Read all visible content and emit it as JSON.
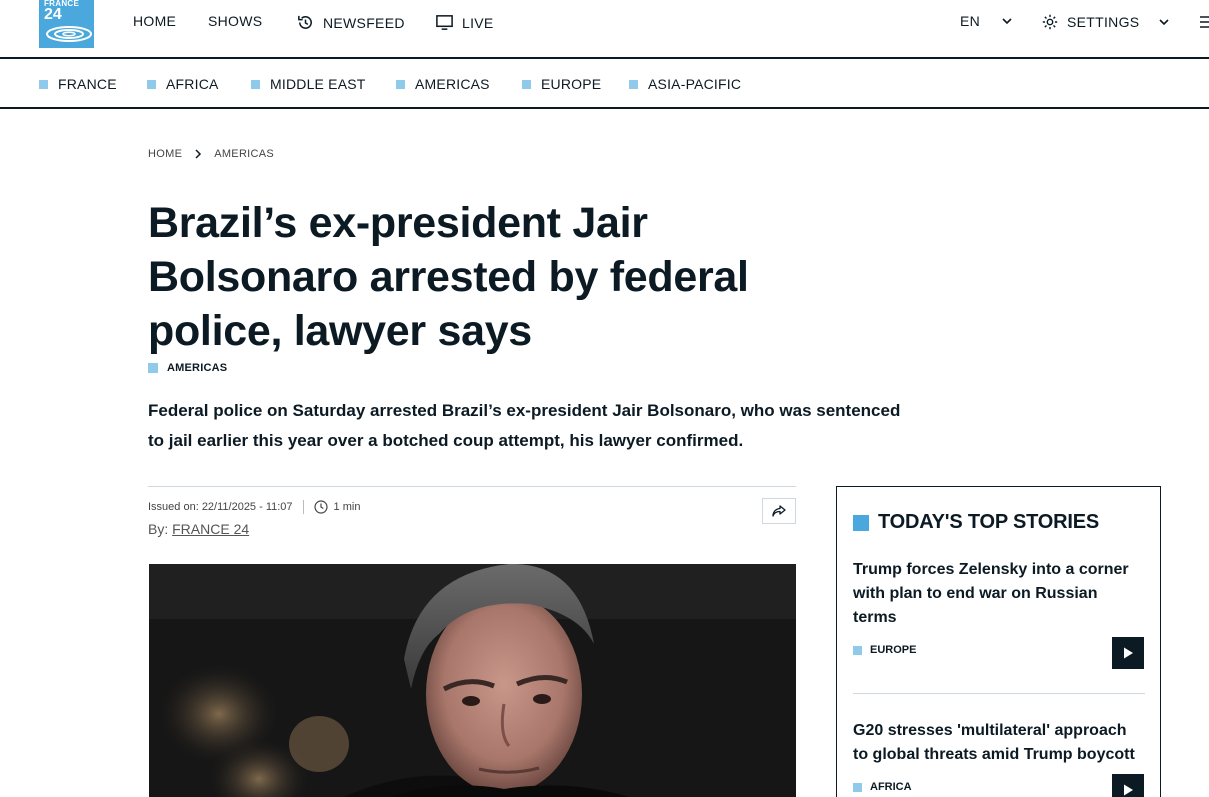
{
  "header": {
    "logo_line1": "FRANCE",
    "logo_line2": "24",
    "nav": {
      "home": "HOME",
      "shows": "SHOWS",
      "newsfeed": "NEWSFEED",
      "live": "LIVE"
    },
    "language": "EN",
    "settings": "SETTINGS"
  },
  "regions": [
    "FRANCE",
    "AFRICA",
    "MIDDLE EAST",
    "AMERICAS",
    "EUROPE",
    "ASIA-PACIFIC"
  ],
  "breadcrumb": {
    "home": "HOME",
    "section": "AMERICAS"
  },
  "article": {
    "title": "Brazil’s ex-president Jair Bolsonaro arrested by federal police, lawyer says",
    "tag": "AMERICAS",
    "lead": "Federal police on Saturday arrested Brazil’s ex-president Jair Bolsonaro, who was sentenced to jail earlier this year over a botched coup attempt, his lawyer confirmed.",
    "issued": "Issued on: 22/11/2025 - 11:07",
    "read_time": "1 min",
    "by_label": "By:",
    "author": "FRANCE 24"
  },
  "sidebar": {
    "title": "TODAY'S TOP STORIES",
    "stories": [
      {
        "title": "Trump forces Zelensky into a corner with plan to end war on Russian terms",
        "category": "EUROPE"
      },
      {
        "title": "G20 stresses 'multilateral' approach to global threats amid Trump boycott",
        "category": "AFRICA"
      }
    ]
  },
  "colors": {
    "accent": "#4aa8dc",
    "accent_light": "#8fcaea",
    "text": "#0c1a24"
  }
}
